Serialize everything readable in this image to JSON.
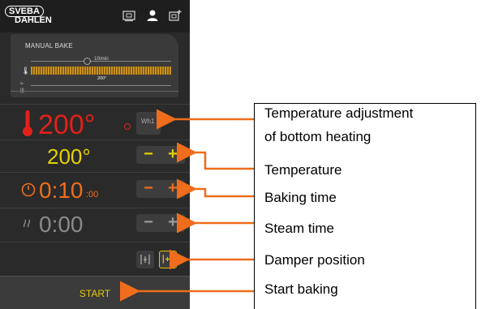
{
  "logo": {
    "line1": "SVEBA",
    "line2": "DAHLEN"
  },
  "top_icons": [
    "recipe-book-icon",
    "user-icon",
    "export-icon"
  ],
  "preview": {
    "title": "MANUAL BAKE",
    "time_label": "10min",
    "temp_label": "200°"
  },
  "bottom_heat": {
    "value": "200°",
    "color": "#e0211a",
    "button_text": "Wh1"
  },
  "temperature": {
    "value": "200°",
    "color": "#e4d100",
    "minus": "−",
    "plus": "+"
  },
  "baking_time": {
    "value": "0:10",
    "seconds": ":00",
    "color": "#ef6d1c",
    "minus": "−",
    "plus": "+"
  },
  "steam_time": {
    "value": "0:00",
    "color": "#8a8a8a",
    "minus": "−",
    "plus": "+"
  },
  "damper": {
    "icons": [
      "damper-closed-icon",
      "damper-open-icon"
    ]
  },
  "start_button": {
    "label": "START"
  },
  "callouts": {
    "bottom_heating_line1": "Temperature adjustment",
    "bottom_heating_line2": "of bottom heating",
    "temperature": "Temperature",
    "baking_time": "Baking time",
    "steam_time": "Steam time",
    "damper": "Damper position",
    "start": "Start baking"
  },
  "colors": {
    "accent_orange": "#ef6d1c",
    "panel_bg": "#2a2a2a",
    "yellow": "#e4c800"
  }
}
